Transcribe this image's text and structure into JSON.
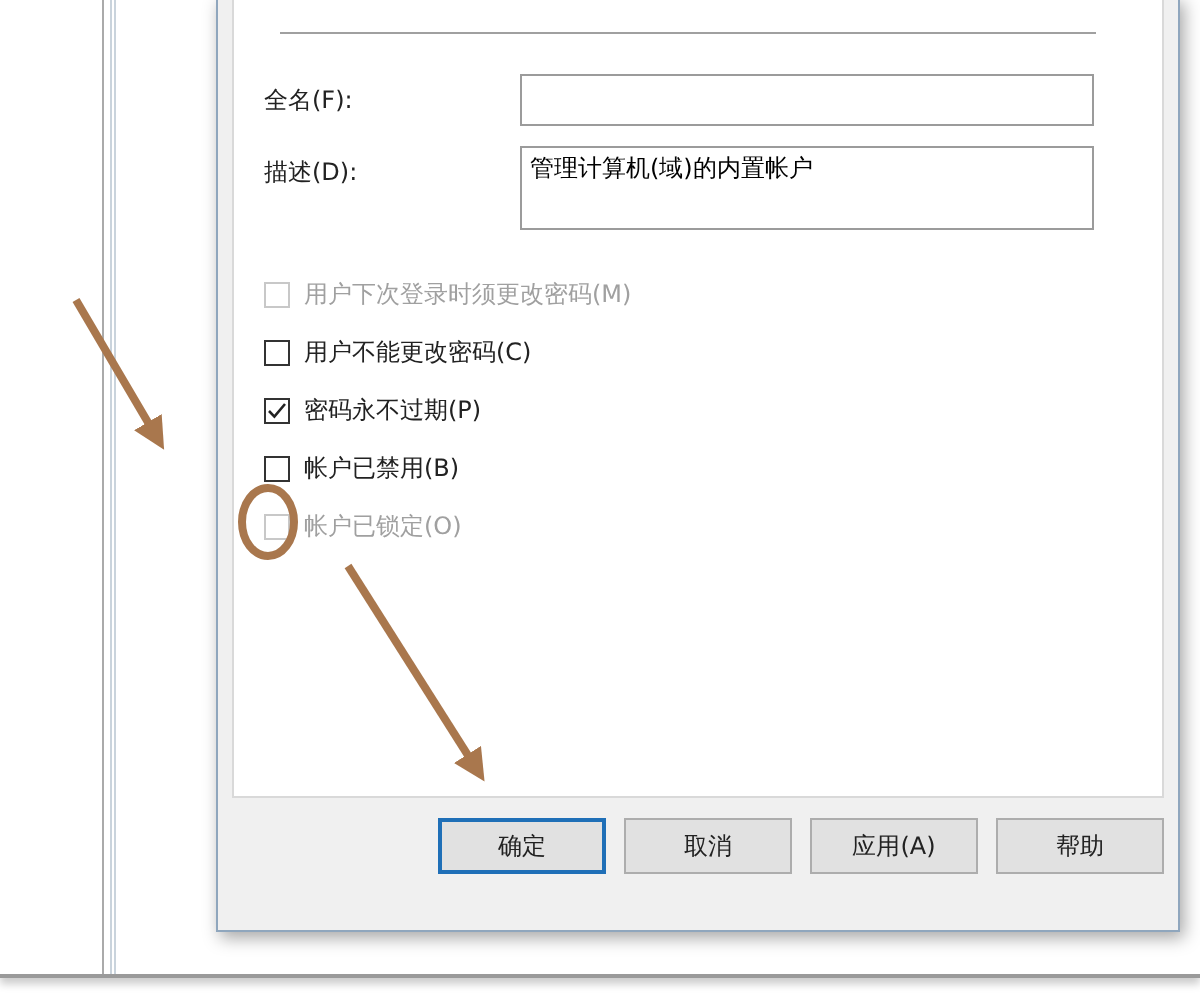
{
  "dialog": {
    "fields": [
      {
        "label": "全名(F):",
        "kind": "line"
      },
      {
        "label": "描述(D):",
        "kind": "multiline",
        "value": "管理计算机(域)的内置帐户"
      }
    ],
    "checkboxes": [
      {
        "label": "用户下次登录时须更改密码(M)",
        "checked": false,
        "disabled": true
      },
      {
        "label": "用户不能更改密码(C)",
        "checked": false,
        "disabled": false
      },
      {
        "label": "密码永不过期(P)",
        "checked": true,
        "disabled": false
      },
      {
        "label": "帐户已禁用(B)",
        "checked": false,
        "disabled": false
      },
      {
        "label": "帐户已锁定(O)",
        "checked": false,
        "disabled": true
      }
    ],
    "buttons": [
      {
        "label": "确定",
        "focused": true
      },
      {
        "label": "取消",
        "focused": false
      },
      {
        "label": "应用(A)",
        "focused": false
      },
      {
        "label": "帮助",
        "focused": false
      }
    ]
  }
}
